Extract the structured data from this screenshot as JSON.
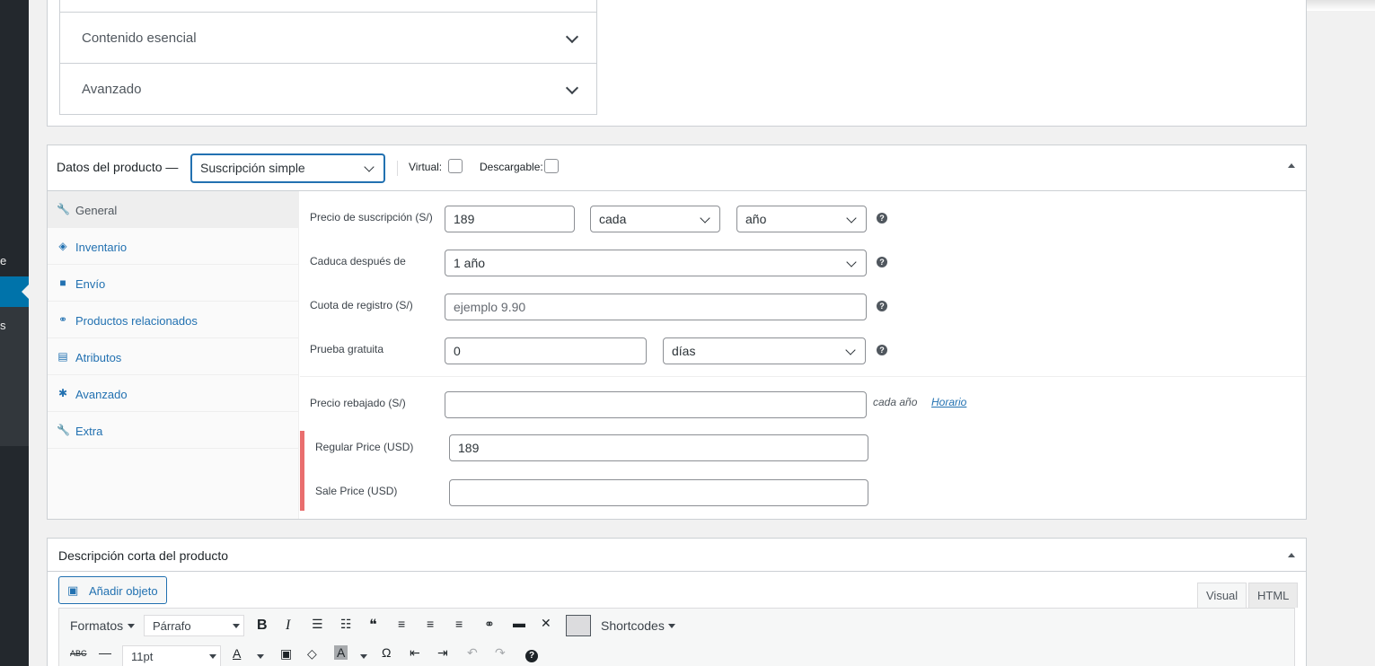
{
  "sidebar": {
    "fragment_1": "e",
    "fragment_2": "s"
  },
  "top_box": {
    "accordion": [
      {
        "label": "Contenido esencial"
      },
      {
        "label": "Avanzado"
      }
    ]
  },
  "product_data": {
    "title": "Datos del producto —",
    "product_type": "Suscripción simple",
    "virtual_label": "Virtual:",
    "downloadable_label": "Descargable:",
    "tabs": [
      {
        "label": "General",
        "icon": "wrench-icon"
      },
      {
        "label": "Inventario",
        "icon": "tag-icon"
      },
      {
        "label": "Envío",
        "icon": "truck-icon"
      },
      {
        "label": "Productos relacionados",
        "icon": "link-icon"
      },
      {
        "label": "Atributos",
        "icon": "list-icon"
      },
      {
        "label": "Avanzado",
        "icon": "gear-icon"
      },
      {
        "label": "Extra",
        "icon": "wrench-icon"
      }
    ],
    "fields": {
      "subscription_price_label": "Precio de suscripción (S/)",
      "subscription_price_value": "189",
      "period_interval": "cada",
      "period": "año",
      "expire_label": "Caduca después de",
      "expire_value": "1 año",
      "signup_fee_label": "Cuota de registro (S/)",
      "signup_fee_placeholder": "ejemplo 9.90",
      "trial_label": "Prueba gratuita",
      "trial_value": "0",
      "trial_period": "días",
      "sale_price_label": "Precio rebajado (S/)",
      "sale_price_suffix": "cada año",
      "schedule_link": "Horario",
      "regular_usd_label": "Regular Price (USD)",
      "regular_usd_value": "189",
      "sale_usd_label": "Sale Price (USD)"
    },
    "help_glyph": "?"
  },
  "short_description": {
    "title": "Descripción corta del producto",
    "add_media_label": "Añadir objeto",
    "tab_visual": "Visual",
    "tab_html": "HTML",
    "toolbar": {
      "formats_label": "Formatos",
      "paragraph_label": "Párrafo",
      "shortcodes_label": "Shortcodes",
      "font_size": "11pt",
      "bold": "B",
      "italic": "I",
      "quote": "❝",
      "omega": "Ω",
      "help": "?"
    }
  }
}
